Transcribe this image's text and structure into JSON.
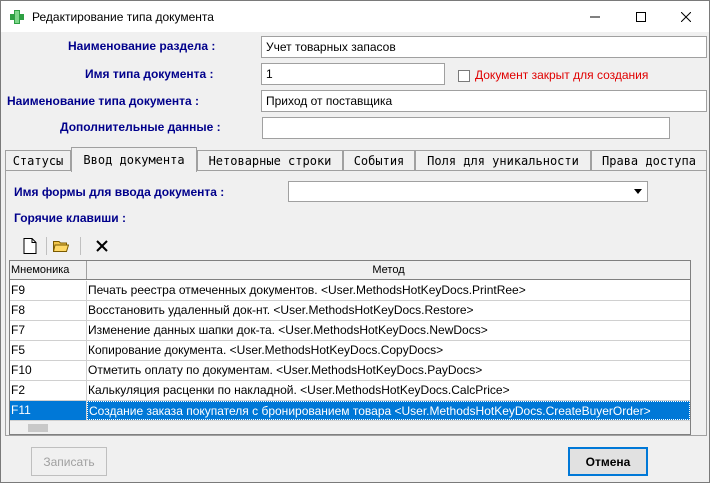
{
  "window": {
    "title": "Редактирование типа документа",
    "minimize": "—",
    "maximize": "☐",
    "close": "✕"
  },
  "form": {
    "section_label": "Наименование раздела :",
    "section_value": "Учет товарных запасов",
    "doctype_label": "Имя типа документа :",
    "doctype_value": "1",
    "closed_checkbox_label": "Документ закрыт для создания",
    "closed_checked": false,
    "docname_label": "Наименование типа документа :",
    "docname_value": "Приход от поставщика",
    "extra_label": "Дополнительные данные :",
    "extra_value": ""
  },
  "tabs": [
    {
      "label": "Статусы",
      "active": false
    },
    {
      "label": "Ввод документа",
      "active": true
    },
    {
      "label": "Нетоварные строки",
      "active": false
    },
    {
      "label": "События",
      "active": false
    },
    {
      "label": "Поля для уникальности",
      "active": false
    },
    {
      "label": "Права доступа",
      "active": false
    }
  ],
  "panel": {
    "form_name_label": "Имя формы для ввода документа :",
    "form_name_value": "",
    "hotkeys_label": "Горячие клавиши :"
  },
  "toolbar": {
    "new_icon": "new-document-icon",
    "open_icon": "folder-open-icon",
    "delete_icon": "delete-x-icon"
  },
  "grid": {
    "columns": [
      "Мнемоника",
      "Метод"
    ],
    "rows": [
      {
        "key": "F9",
        "method": "Печать реестра отмеченных документов.  <User.MethodsHotKeyDocs.PrintRee>",
        "selected": false
      },
      {
        "key": "F8",
        "method": "Восстановить удаленный док-нт.  <User.MethodsHotKeyDocs.Restore>",
        "selected": false
      },
      {
        "key": "F7",
        "method": "Изменение данных шапки док-та.  <User.MethodsHotKeyDocs.NewDocs>",
        "selected": false
      },
      {
        "key": "F5",
        "method": "Копирование документа.  <User.MethodsHotKeyDocs.CopyDocs>",
        "selected": false
      },
      {
        "key": "F10",
        "method": "Отметить оплату по документам.  <User.MethodsHotKeyDocs.PayDocs>",
        "selected": false
      },
      {
        "key": "F2",
        "method": "Калькуляция расценки по накладной.  <User.MethodsHotKeyDocs.CalcPrice>",
        "selected": false
      },
      {
        "key": "F11",
        "method": "Создание заказа покупателя с бронированием товара  <User.MethodsHotKeyDocs.CreateBuyerOrder>",
        "selected": true
      }
    ]
  },
  "buttons": {
    "save_label": "Записать",
    "cancel_label": "Отмена"
  },
  "colors": {
    "label_blue": "#00008b",
    "accent": "#0078d7",
    "warning_red": "#e00000"
  }
}
